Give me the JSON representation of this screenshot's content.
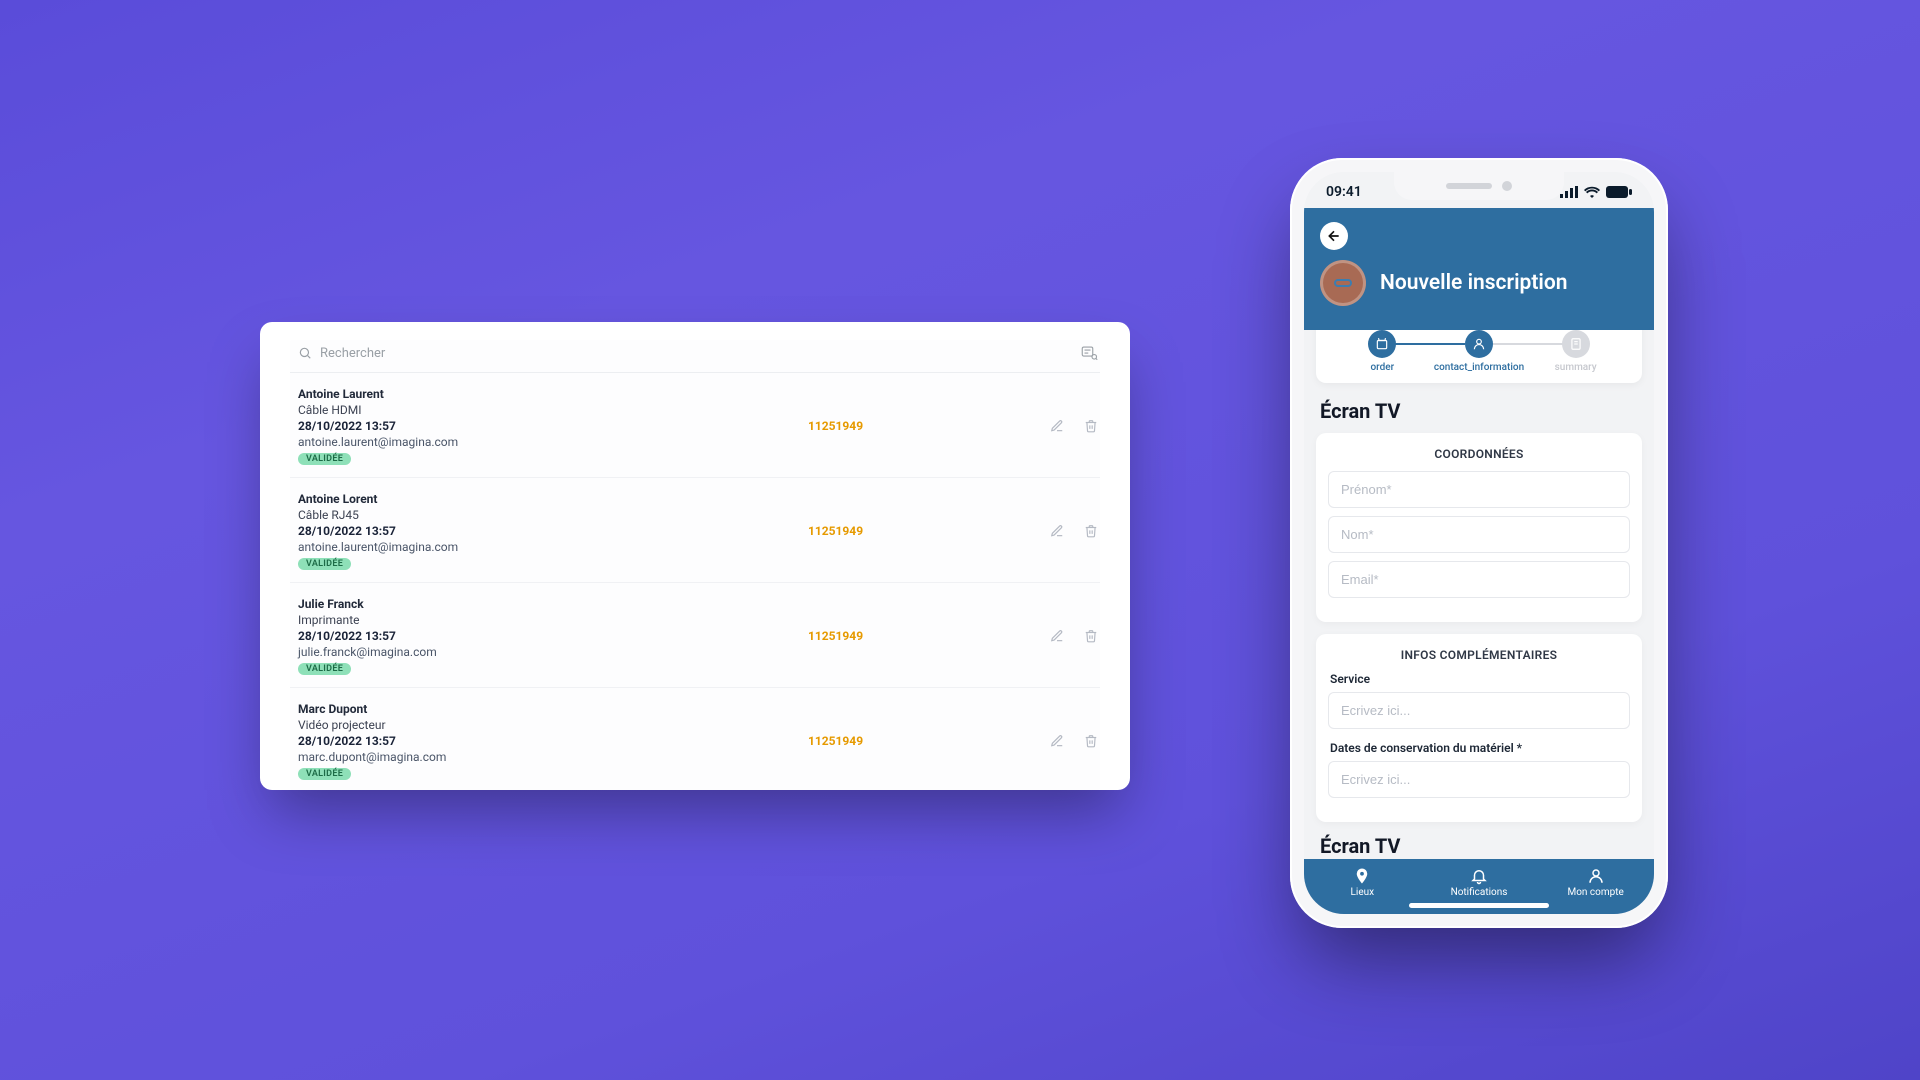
{
  "desktop": {
    "search_placeholder": "Rechercher",
    "rows": [
      {
        "name": "Antoine Laurent",
        "product": "Câble HDMI",
        "date": "28/10/2022 13:57",
        "email": "antoine.laurent@imagina.com",
        "status": "VALIDÉE",
        "ref": "11251949"
      },
      {
        "name": "Antoine Lorent",
        "product": "Câble RJ45",
        "date": "28/10/2022 13:57",
        "email": "antoine.laurent@imagina.com",
        "status": "VALIDÉE",
        "ref": "11251949"
      },
      {
        "name": "Julie Franck",
        "product": "Imprimante",
        "date": "28/10/2022 13:57",
        "email": "julie.franck@imagina.com",
        "status": "VALIDÉE",
        "ref": "11251949"
      },
      {
        "name": "Marc Dupont",
        "product": "Vidéo projecteur",
        "date": "28/10/2022 13:57",
        "email": "marc.dupont@imagina.com",
        "status": "VALIDÉE",
        "ref": "11251949"
      }
    ]
  },
  "phone": {
    "status_time": "09:41",
    "header_title": "Nouvelle inscription",
    "steps": [
      {
        "label": "order",
        "state": "active"
      },
      {
        "label": "contact_information",
        "state": "active"
      },
      {
        "label": "summary",
        "state": "disabled"
      }
    ],
    "section_title": "Écran TV",
    "section_title_2": "Écran TV",
    "form": {
      "coord_heading": "COORDONNÉES",
      "firstname_placeholder": "Prénom*",
      "lastname_placeholder": "Nom*",
      "email_placeholder": "Email*",
      "extra_heading": "INFOS COMPLÉMENTAIRES",
      "service_label": "Service",
      "service_placeholder": "Ecrivez ici...",
      "dates_label": "Dates de conservation du matériel *",
      "dates_placeholder": "Ecrivez ici..."
    },
    "tabs": {
      "places": "Lieux",
      "notifications": "Notifications",
      "account": "Mon compte"
    }
  }
}
